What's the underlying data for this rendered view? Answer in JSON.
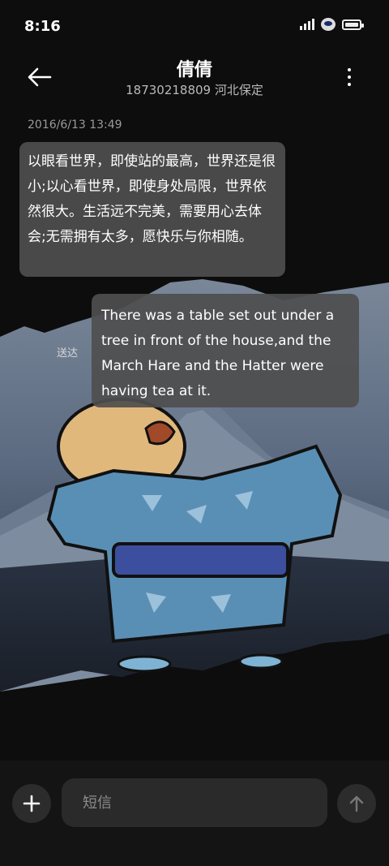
{
  "status": {
    "time": "8:16"
  },
  "header": {
    "contact_name": "倩倩",
    "contact_info": "18730218809 河北保定"
  },
  "conversation": {
    "timestamp": "2016/6/13 13:49",
    "messages": [
      {
        "direction": "incoming",
        "text": "以眼看世界，即使站的最高，世界还是很小;以心看世界，即使身处局限，世界依然很大。生活远不完美，需要用心去体会;无需拥有太多，愿快乐与你相随。"
      },
      {
        "direction": "outgoing",
        "text": "There was a table set out under a tree in front of the house,and the March Hare and the Hatter were having tea at it.",
        "status": "送达"
      }
    ]
  },
  "composer": {
    "placeholder": "短信"
  },
  "icons": {
    "back": "arrow-left-icon",
    "more": "more-vertical-icon",
    "add": "plus-icon",
    "send": "arrow-up-icon"
  },
  "colors": {
    "background": "#0d0d0d",
    "bubble": "#4e4e4e",
    "input": "#2a2a2a"
  }
}
